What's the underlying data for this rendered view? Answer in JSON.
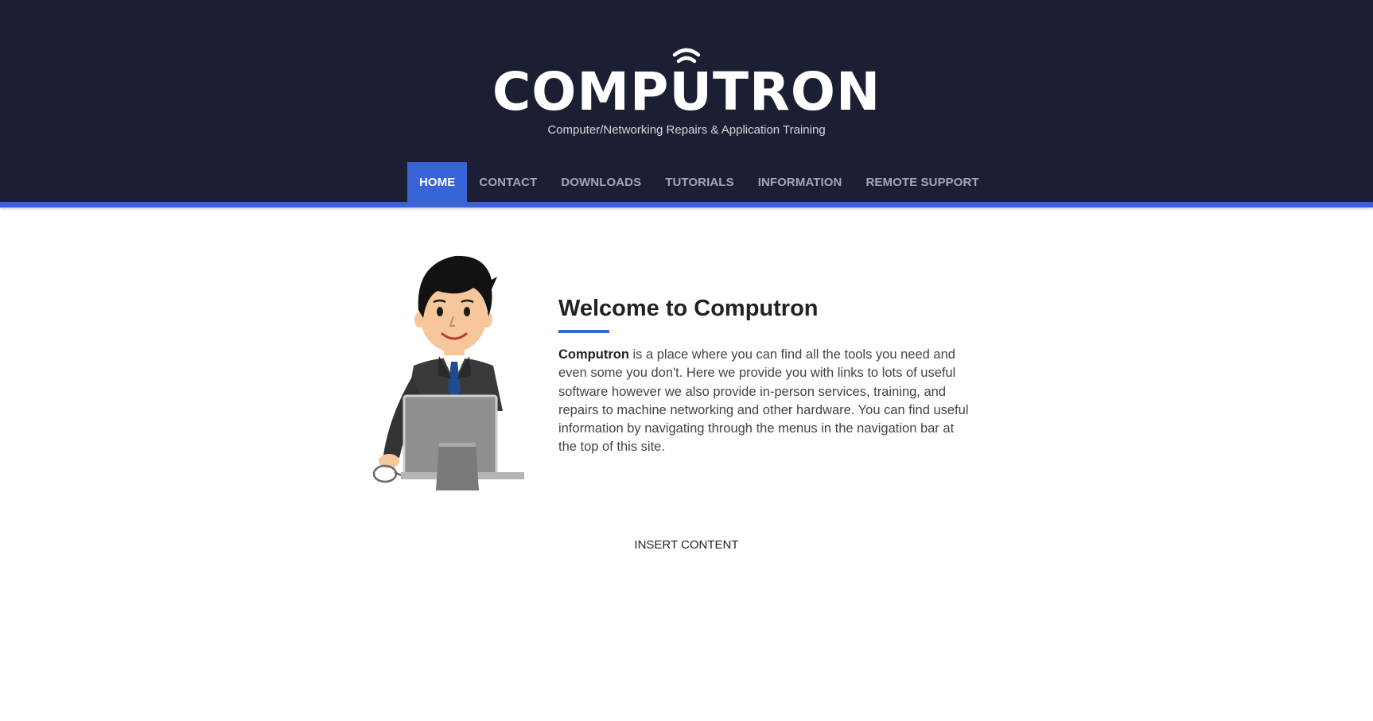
{
  "site": {
    "brand_name": "COMPUTRON",
    "tagline": "Computer/Networking Repairs & Application Training"
  },
  "nav": {
    "items": [
      {
        "label": "HOME",
        "active": true
      },
      {
        "label": "CONTACT",
        "active": false
      },
      {
        "label": "DOWNLOADS",
        "active": false
      },
      {
        "label": "TUTORIALS",
        "active": false
      },
      {
        "label": "INFORMATION",
        "active": false
      },
      {
        "label": "REMOTE SUPPORT",
        "active": false
      }
    ]
  },
  "main": {
    "title": "Welcome to Computron",
    "intro_bold": "Computron",
    "intro_text": " is a place where you can find all the tools you need and even some you don't. Here we provide you with links to lots of useful software however we also provide in-person services, training, and repairs to machine networking and other hardware. You can find useful information by navigating through the menus in the navigation bar at the top of this site.",
    "illustration": "businessman-at-computer-icon",
    "insert_content": "INSERT CONTENT"
  },
  "colors": {
    "header_bg": "#1c1f33",
    "accent": "#3864d6",
    "nav_text": "#a3a6b2",
    "body_text": "#444444"
  }
}
